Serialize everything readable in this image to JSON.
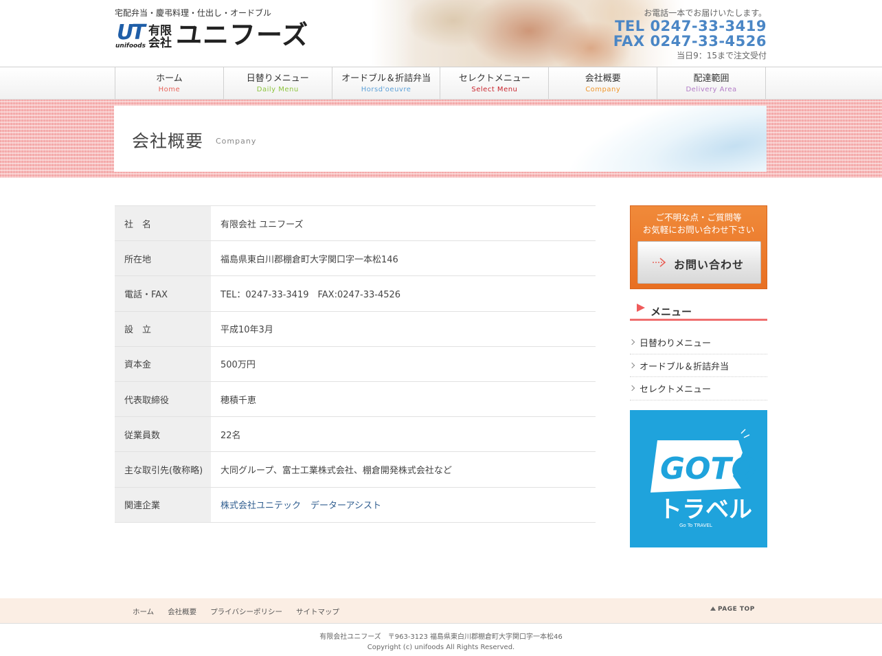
{
  "header": {
    "tagline": "宅配弁当・慶弔料理・仕出し・オードブル",
    "logo": {
      "mark": "UT",
      "mark_sub": "unifoods",
      "small_line1": "有限",
      "small_line2": "会社",
      "name": "ユニフーズ"
    },
    "contact": {
      "note": "お電話一本でお届けいたします。",
      "tel": "TEL 0247-33-3419",
      "fax": "FAX 0247-33-4526",
      "hours": "当日9：15まで注文受付"
    }
  },
  "nav": {
    "items": [
      {
        "ja": "ホーム",
        "en": "Home",
        "color": "#e8635a"
      },
      {
        "ja": "日替りメニュー",
        "en": "Daily Menu",
        "color": "#8cc43c"
      },
      {
        "ja": "オードブル＆折詰弁当",
        "en": "Horsd'oeuvre",
        "color": "#5ba0d8"
      },
      {
        "ja": "セレクトメニュー",
        "en": "Select Menu",
        "color": "#c8232c"
      },
      {
        "ja": "会社概要",
        "en": "Company",
        "color": "#f0962a"
      },
      {
        "ja": "配達範囲",
        "en": "Delivery Area",
        "color": "#b27bc7"
      }
    ]
  },
  "page_title": {
    "ja": "会社概要",
    "en": "Company"
  },
  "company": {
    "rows": [
      {
        "label": "社　名",
        "value": "有限会社 ユニフーズ"
      },
      {
        "label": "所在地",
        "value": "福島県東白川郡棚倉町大字関口字一本松146"
      },
      {
        "label": "電話・FAX",
        "value": "TEL：0247-33-3419　FAX:0247-33-4526"
      },
      {
        "label": "設　立",
        "value": "平成10年3月"
      },
      {
        "label": "資本金",
        "value": "500万円"
      },
      {
        "label": "代表取締役",
        "value": "穂積千恵"
      },
      {
        "label": "従業員数",
        "value": "22名"
      },
      {
        "label": "主な取引先(敬称略)",
        "value": "大同グループ、富士工業株式会社、棚倉開発株式会社など"
      }
    ],
    "related": {
      "label": "関連企業",
      "links": [
        "株式会社ユニテック",
        "データーアシスト"
      ]
    }
  },
  "sidebar": {
    "inquiry": {
      "line1": "ご不明な点・ご質問等",
      "line2": "お気軽にお問い合わせ下さい",
      "button": "お問い合わせ"
    },
    "menu": {
      "title": "メニュー",
      "items": [
        "日替わりメニュー",
        "オードブル＆折詰弁当",
        "セレクトメニュー"
      ]
    },
    "banner": {
      "line1": "GOTO",
      "line2": "トラベル",
      "line3": "Go To TRAVEL",
      "color": "#1fa3dc"
    }
  },
  "footer": {
    "links": [
      "ホーム",
      "会社概要",
      "プライバシーポリシー",
      "サイトマップ"
    ],
    "page_top": "PAGE TOP",
    "address": "有限会社ユニフーズ　〒963-3123 福島県東白川郡棚倉町大字関口字一本松46",
    "copyright": "Copyright (c) unifoods All Rights Reserved."
  }
}
